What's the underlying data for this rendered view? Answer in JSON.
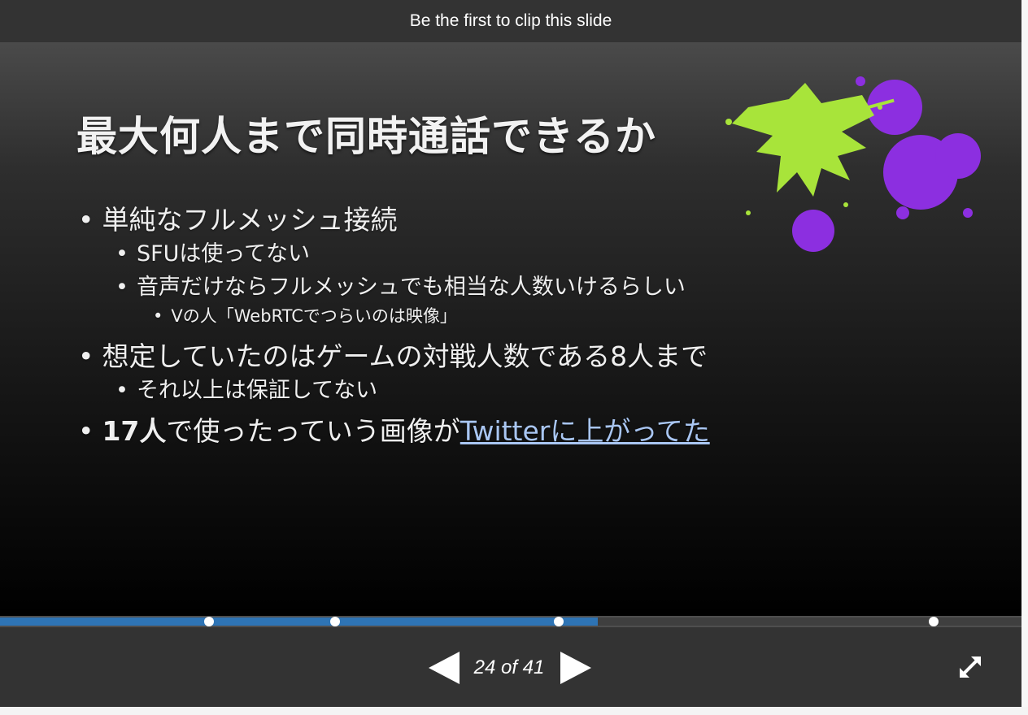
{
  "clip_bar": {
    "text": "Be the first to clip this slide"
  },
  "slide": {
    "title": "最大何人まで同時通話できるか",
    "bullet_glyph": "•",
    "bullets": [
      {
        "text": "単純なフルメッシュ接続"
      },
      {
        "text": "SFUは使ってない"
      },
      {
        "text": "音声だけならフルメッシュでも相当な人数いけるらしい"
      },
      {
        "text": "Vの人「WebRTCでつらいのは映像」"
      },
      {
        "text": "想定していたのはゲームの対戦人数である8人まで"
      },
      {
        "text": "それ以上は保証してない"
      },
      {
        "strong": "17人",
        "text": "で使ったっていう画像が",
        "link": "Twitterに上がってた"
      }
    ],
    "colors": {
      "splat_green": "#a8e43a",
      "splat_purple": "#8c2fe0",
      "link": "#a9c6f2"
    }
  },
  "progress": {
    "fraction": 0.585,
    "marker_fractions": [
      0.205,
      0.328,
      0.547,
      0.914
    ],
    "fill_color": "#2e74b5"
  },
  "controls": {
    "counter": "24 of 41",
    "prev_icon": "triangle-left-icon",
    "next_icon": "triangle-right-icon",
    "fullscreen_icon": "expand-arrows-icon"
  }
}
